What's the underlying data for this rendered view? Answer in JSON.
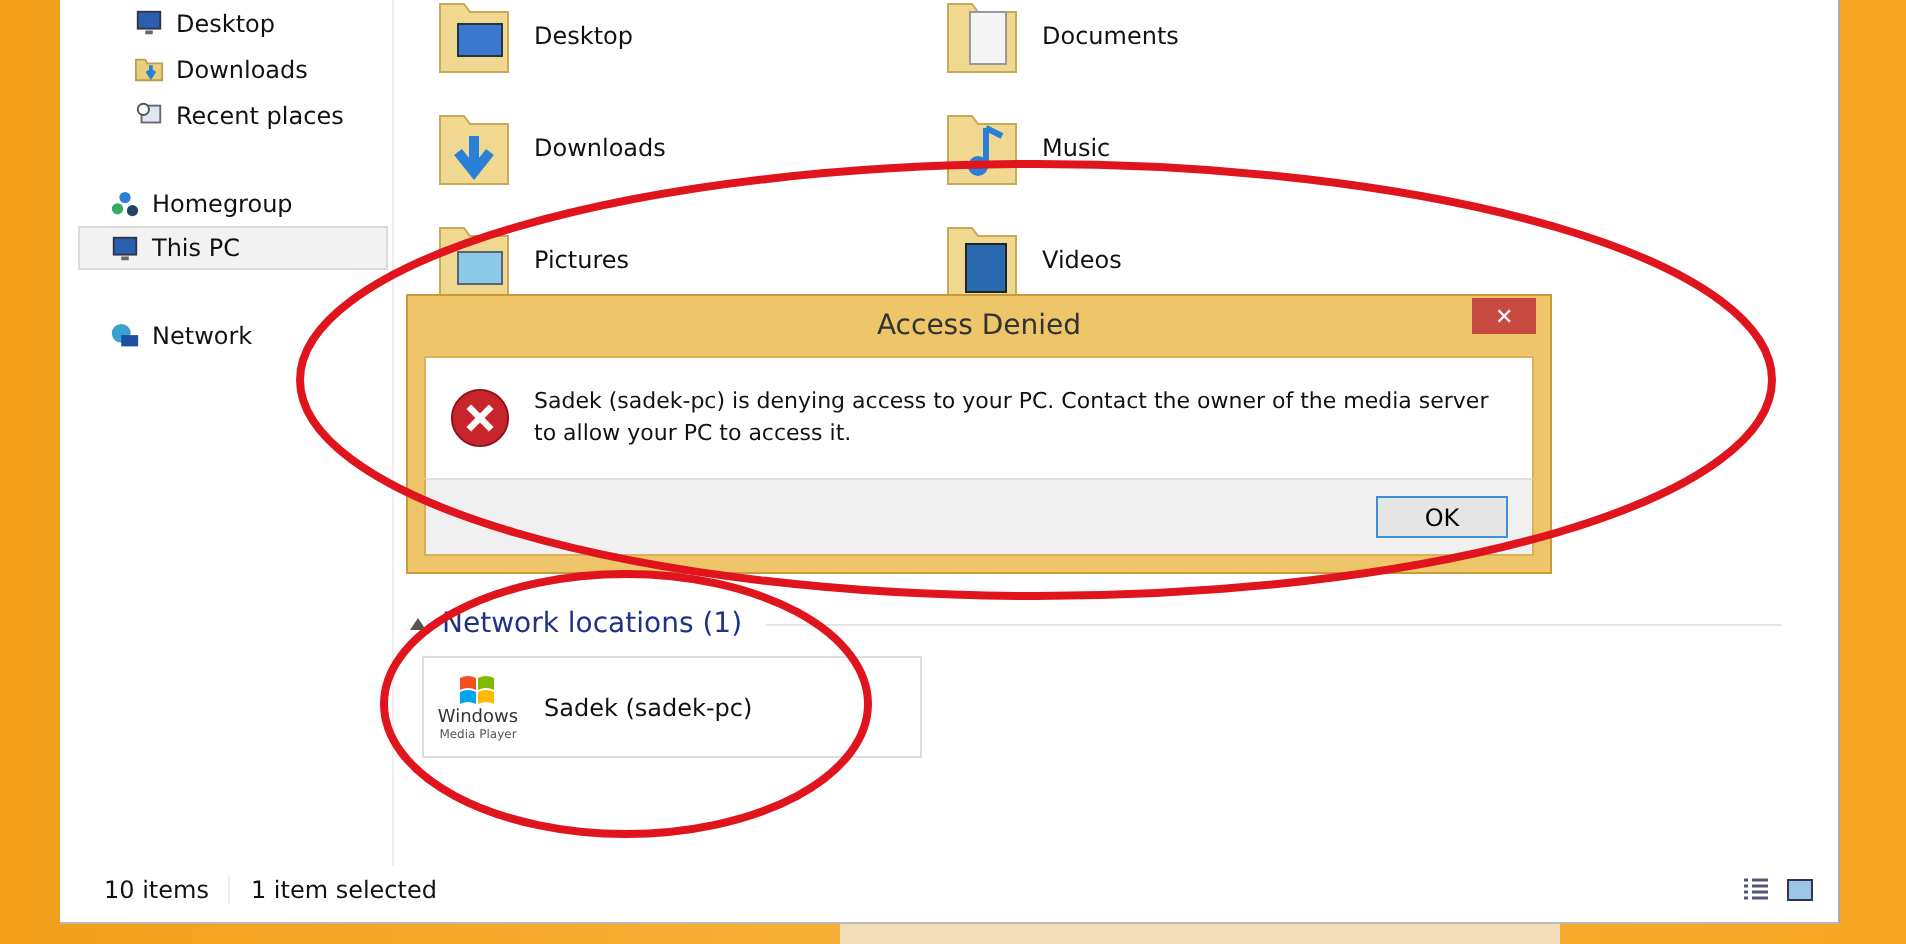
{
  "sidebar": {
    "items": [
      {
        "label": "Desktop",
        "kind": "desktop",
        "selected": false,
        "indent": true
      },
      {
        "label": "Downloads",
        "kind": "downloads",
        "selected": false,
        "indent": true
      },
      {
        "label": "Recent places",
        "kind": "recent",
        "selected": false,
        "indent": true
      },
      {
        "label": "Homegroup",
        "kind": "homegroup",
        "selected": false,
        "indent": false
      },
      {
        "label": "This PC",
        "kind": "pc",
        "selected": true,
        "indent": false
      },
      {
        "label": "Network",
        "kind": "network",
        "selected": false,
        "indent": false
      }
    ]
  },
  "folders": [
    {
      "label": "Desktop",
      "kind": "desktop"
    },
    {
      "label": "Documents",
      "kind": "documents"
    },
    {
      "label": "Downloads",
      "kind": "downloads"
    },
    {
      "label": "Music",
      "kind": "music"
    },
    {
      "label": "Pictures",
      "kind": "pictures"
    },
    {
      "label": "Videos",
      "kind": "videos"
    }
  ],
  "network_locations": {
    "header": "Network locations (1)",
    "expanded": true,
    "items": [
      {
        "label": "Sadek (sadek-pc)",
        "logo_line_1": "Windows",
        "logo_line_2": "Media Player"
      }
    ]
  },
  "status_bar": {
    "count": "10 items",
    "selection": "1 item selected"
  },
  "dialog": {
    "title": "Access Denied",
    "close": "✕",
    "message": "Sadek (sadek-pc) is denying access to your PC. Contact the owner of the media server to allow your PC to access it.",
    "button": "OK"
  },
  "annotations": [
    {
      "kind": "ellipse"
    },
    {
      "kind": "ellipse"
    }
  ]
}
